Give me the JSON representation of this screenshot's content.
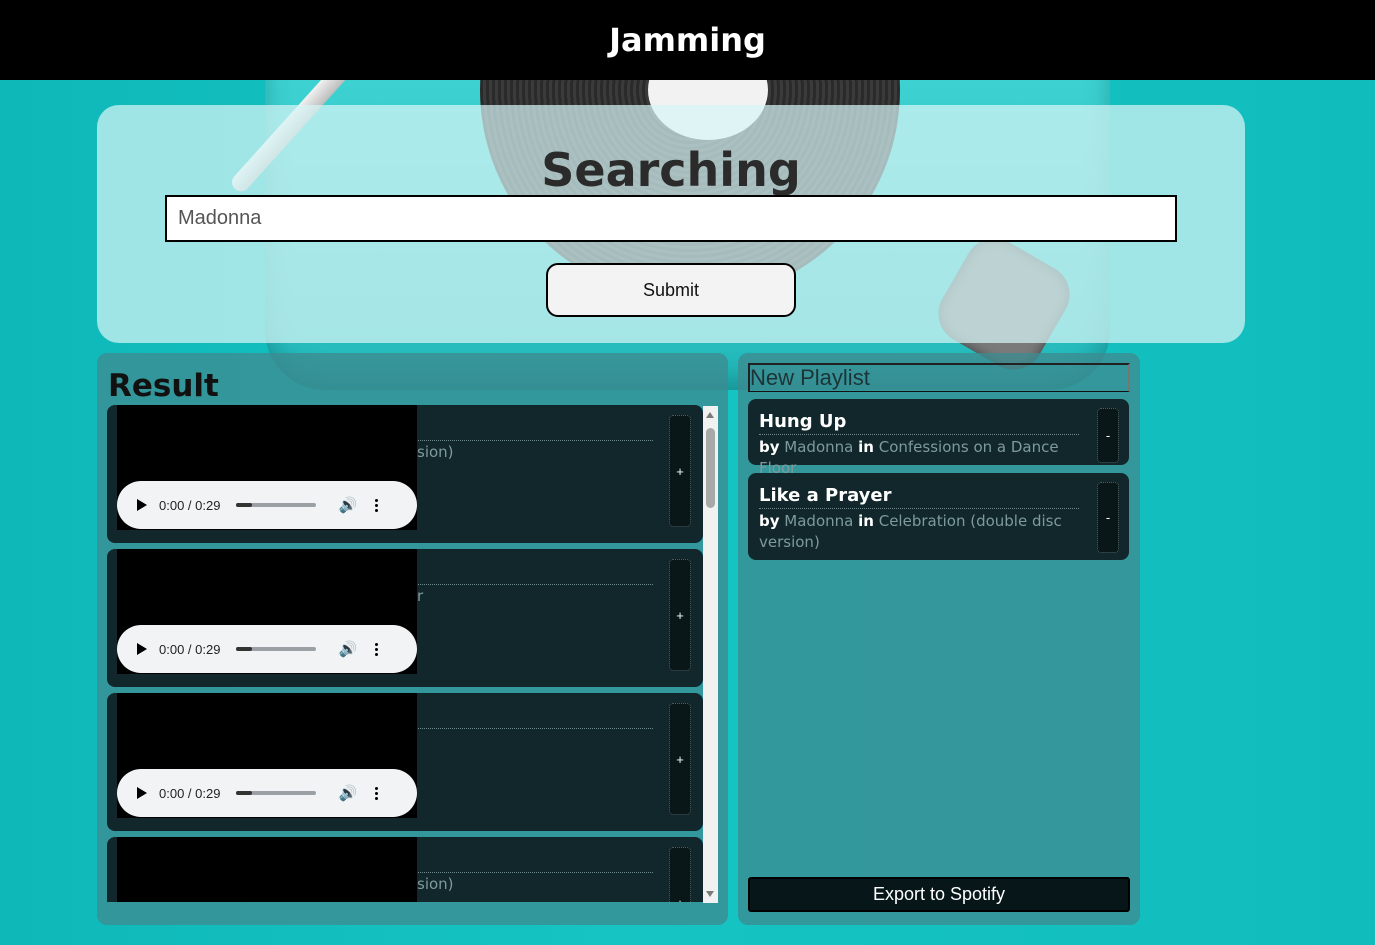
{
  "header": {
    "title": "Jamming"
  },
  "search": {
    "title": "Searching",
    "value": "Madonna",
    "submit_label": "Submit"
  },
  "results": {
    "title": "Result",
    "add_label": "+",
    "items": [
      {
        "visible_meta": "sion)",
        "player": {
          "time": "0:00 / 0:29"
        }
      },
      {
        "visible_meta": "r",
        "player": {
          "time": "0:00 / 0:29"
        }
      },
      {
        "visible_meta": "",
        "player": {
          "time": "0:00 / 0:29"
        }
      },
      {
        "visible_meta": "sion)",
        "player": null
      }
    ]
  },
  "playlist": {
    "name": "New Playlist",
    "remove_label": "-",
    "by_label": "by",
    "in_label": "in",
    "tracks": [
      {
        "title": "Hung Up",
        "artist": "Madonna",
        "album": "Confessions on a Dance Floor"
      },
      {
        "title": "Like a Prayer",
        "artist": "Madonna",
        "album": "Celebration (double disc version)"
      }
    ],
    "export_label": "Export to Spotify"
  }
}
